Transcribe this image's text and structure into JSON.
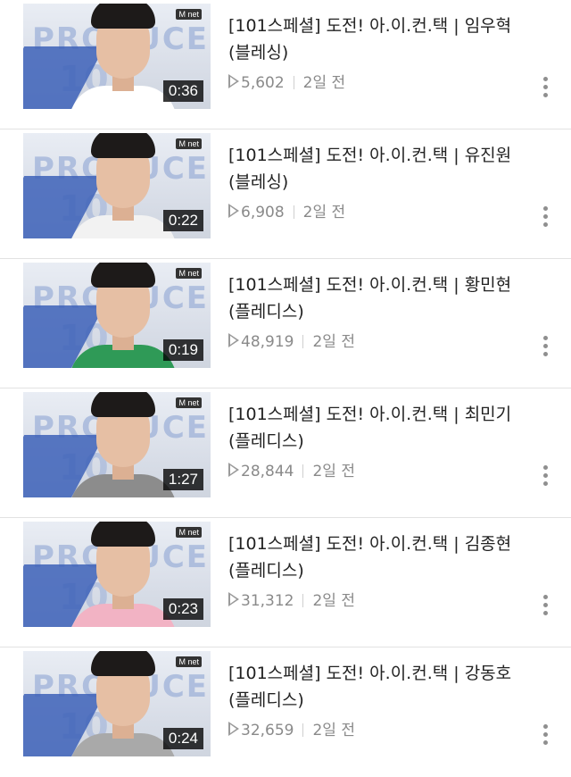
{
  "videos": [
    {
      "title": "[101스페셜] 도전! 아.이.컨.택 | 임우혁 (블레싱)",
      "views": "5,602",
      "age": "2일 전",
      "duration": "0:36",
      "shirt_color": "#ffffff",
      "thumb_brand": "M net"
    },
    {
      "title": "[101스페셜] 도전! 아.이.컨.택 | 유진원 (블레싱)",
      "views": "6,908",
      "age": "2일 전",
      "duration": "0:22",
      "shirt_color": "#f2f2f2",
      "thumb_brand": "M net"
    },
    {
      "title": "[101스페셜] 도전! 아.이.컨.택 | 황민현 (플레디스)",
      "views": "48,919",
      "age": "2일 전",
      "duration": "0:19",
      "shirt_color": "#2f9a57",
      "thumb_brand": "M net"
    },
    {
      "title": "[101스페셜] 도전! 아.이.컨.택 | 최민기 (플레디스)",
      "views": "28,844",
      "age": "2일 전",
      "duration": "1:27",
      "shirt_color": "#8c8c8c",
      "thumb_brand": "M net"
    },
    {
      "title": "[101스페셜] 도전! 아.이.컨.택 | 김종현 (플레디스)",
      "views": "31,312",
      "age": "2일 전",
      "duration": "0:23",
      "shirt_color": "#f2b3c4",
      "thumb_brand": "M net"
    },
    {
      "title": "[101스페셜] 도전! 아.이.컨.택 | 강동호 (플레디스)",
      "views": "32,659",
      "age": "2일 전",
      "duration": "0:24",
      "shirt_color": "#a9a9a9",
      "thumb_brand": "M net"
    }
  ],
  "icons": {
    "play": "play-icon",
    "more": "more-vert-icon"
  }
}
